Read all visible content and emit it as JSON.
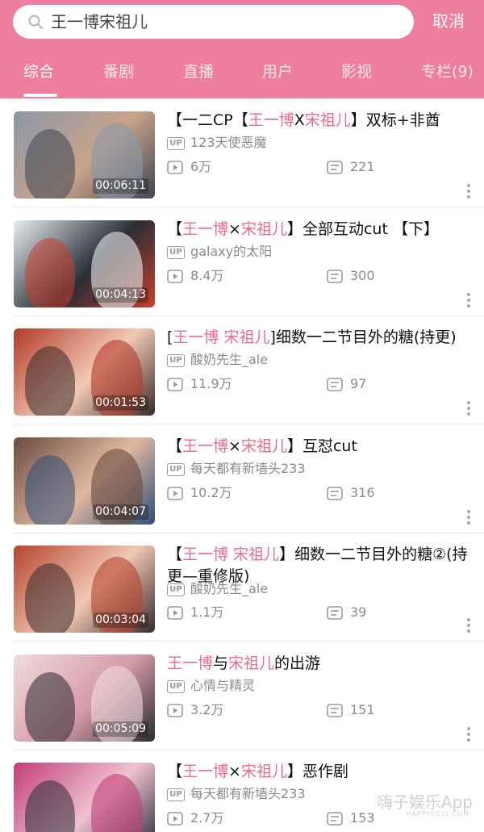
{
  "search": {
    "query": "王一博宋祖儿",
    "cancel_label": "取消"
  },
  "tabs": [
    {
      "label": "综合",
      "active": true
    },
    {
      "label": "番剧",
      "active": false
    },
    {
      "label": "直播",
      "active": false
    },
    {
      "label": "用户",
      "active": false
    },
    {
      "label": "影视",
      "active": false
    },
    {
      "label": "专栏(9)",
      "active": false
    }
  ],
  "results": [
    {
      "title_parts": [
        {
          "text": "【一二CP【",
          "highlight": false
        },
        {
          "text": "王一博",
          "highlight": true
        },
        {
          "text": "X",
          "highlight": false
        },
        {
          "text": "宋祖儿",
          "highlight": true
        },
        {
          "text": "】双标+非酋",
          "highlight": false
        }
      ],
      "uploader": "123天使恶魔",
      "views": "6万",
      "comments": "221",
      "duration": "00:06:11",
      "thumb_colors": [
        "#8a97a8",
        "#c9a48a",
        "#3e4552"
      ]
    },
    {
      "title_parts": [
        {
          "text": "【",
          "highlight": false
        },
        {
          "text": "王一博",
          "highlight": true
        },
        {
          "text": "×",
          "highlight": false
        },
        {
          "text": "宋祖儿",
          "highlight": true
        },
        {
          "text": "】全部互动cut 【下】",
          "highlight": false
        }
      ],
      "uploader": "galaxy的太阳",
      "views": "8.4万",
      "comments": "300",
      "duration": "00:04:13",
      "thumb_colors": [
        "#e9ecef",
        "#2a2d36",
        "#c6402e"
      ]
    },
    {
      "title_parts": [
        {
          "text": "[",
          "highlight": false
        },
        {
          "text": "王一博 宋祖儿",
          "highlight": true
        },
        {
          "text": "]细数一二节目外的糖(持更)",
          "highlight": false
        }
      ],
      "uploader": "酸奶先生_ale",
      "views": "11.9万",
      "comments": "97",
      "duration": "00:01:53",
      "thumb_colors": [
        "#b23a2a",
        "#f3c9b4",
        "#3b2a2a"
      ]
    },
    {
      "title_parts": [
        {
          "text": "【",
          "highlight": false
        },
        {
          "text": "王一博",
          "highlight": true
        },
        {
          "text": "×",
          "highlight": false
        },
        {
          "text": "宋祖儿",
          "highlight": true
        },
        {
          "text": "】互怼cut",
          "highlight": false
        }
      ],
      "uploader": "每天都有新墙头233",
      "views": "10.2万",
      "comments": "316",
      "duration": "00:04:07",
      "thumb_colors": [
        "#6a4a3e",
        "#e1b9a0",
        "#2f4f7a"
      ]
    },
    {
      "title_parts": [
        {
          "text": "【",
          "highlight": false
        },
        {
          "text": "王一博 宋祖儿",
          "highlight": true
        },
        {
          "text": "】细数一二节目外的糖②(持更—重修版)",
          "highlight": false
        }
      ],
      "uploader": "酸奶先生_ale",
      "views": "1.1万",
      "comments": "39",
      "duration": "00:03:04",
      "thumb_colors": [
        "#b5442e",
        "#f1c7b3",
        "#3a2a2a"
      ]
    },
    {
      "title_parts": [
        {
          "text": "王一博",
          "highlight": true
        },
        {
          "text": "与",
          "highlight": false
        },
        {
          "text": "宋祖儿",
          "highlight": true
        },
        {
          "text": "的出游",
          "highlight": false
        }
      ],
      "uploader": "心情与精灵",
      "views": "3.2万",
      "comments": "151",
      "duration": "00:05:09",
      "thumb_colors": [
        "#f0dce0",
        "#d59aa8",
        "#2c2c30"
      ]
    },
    {
      "title_parts": [
        {
          "text": "【",
          "highlight": false
        },
        {
          "text": "王一博",
          "highlight": true
        },
        {
          "text": "×",
          "highlight": false
        },
        {
          "text": "宋祖儿",
          "highlight": true
        },
        {
          "text": "】恶作剧",
          "highlight": false
        }
      ],
      "uploader": "每天都有新墙头233",
      "views": "2.7万",
      "comments": "153",
      "duration": "",
      "thumb_colors": [
        "#c23d7a",
        "#f0c2cf",
        "#2b2b3a"
      ]
    }
  ],
  "watermark": {
    "main": "嗨子娱乐App",
    "sub": "HAPPYCOLI.COM"
  },
  "colors": {
    "header": "#ee7e9d",
    "highlight": "#e86c8c"
  }
}
